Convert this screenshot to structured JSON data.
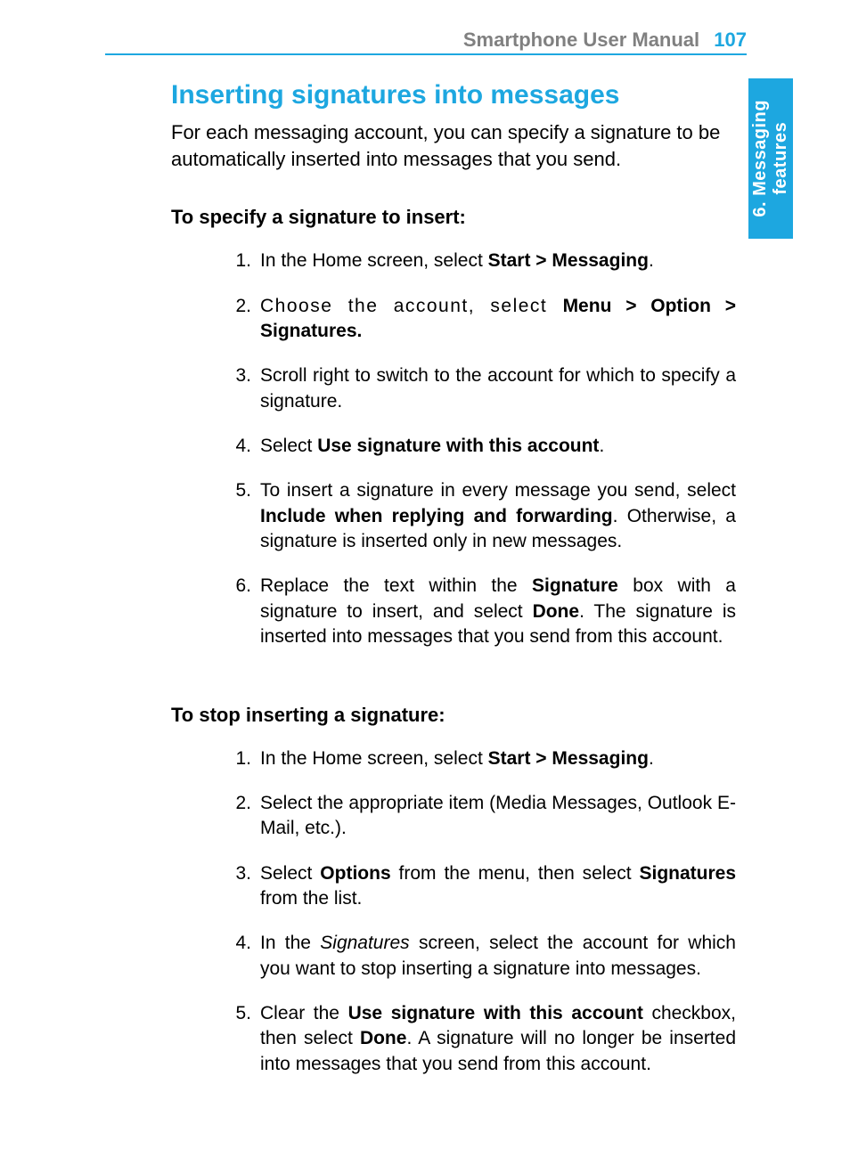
{
  "header": {
    "title": "Smartphone User Manual",
    "page_number": "107"
  },
  "side_tab": {
    "line1": "6. Messaging",
    "line2": "features"
  },
  "main": {
    "title": "Inserting signatures into messages",
    "intro": "For each messaging account, you can specify a signature to be automatically inserted into messages that you send.",
    "section1": {
      "heading": "To specify a signature to insert:",
      "steps": [
        {
          "pre": "In the Home screen, select ",
          "bold1": "Start > Messaging",
          "post1": "."
        },
        {
          "pre_spread": "Choose the account, select ",
          "bold1": "Menu > Option > Signatures."
        },
        {
          "pre": "Scroll right to switch to the account for which to specify a signature."
        },
        {
          "pre": "Select ",
          "bold1": "Use signature with this account",
          "post1": "."
        },
        {
          "pre": "To insert a signature in every message you send, select ",
          "bold1": "Include when replying and forwarding",
          "post1": ".  Otherwise, a signature is inserted only in new messages."
        },
        {
          "pre": "Replace the text within the ",
          "bold1": "Signature",
          "mid1": " box with a signature to insert, and select ",
          "bold2": "Done",
          "post2": ".  The signature is inserted into messages that you send from this account."
        }
      ]
    },
    "section2": {
      "heading": "To stop inserting a signature:",
      "steps": [
        {
          "pre": "In the Home screen, select ",
          "bold1": "Start > Messaging",
          "post1": "."
        },
        {
          "pre": "Select the appropriate item (Media Messages, Outlook E-Mail, etc.)."
        },
        {
          "pre": "Select ",
          "bold1": "Options",
          "mid1": " from the menu, then select ",
          "bold2": "Signatures",
          "post2": " from the list."
        },
        {
          "pre": "In the ",
          "ital1": "Signatures",
          "mid1": " screen, select the account for which you want to stop inserting a signature into messages."
        },
        {
          "pre": "Clear the ",
          "bold1": "Use signature with this account",
          "mid1": " checkbox, then select ",
          "bold2": "Done",
          "post2": ".  A signature will no longer be inserted into messages that you send from this account."
        }
      ]
    }
  }
}
